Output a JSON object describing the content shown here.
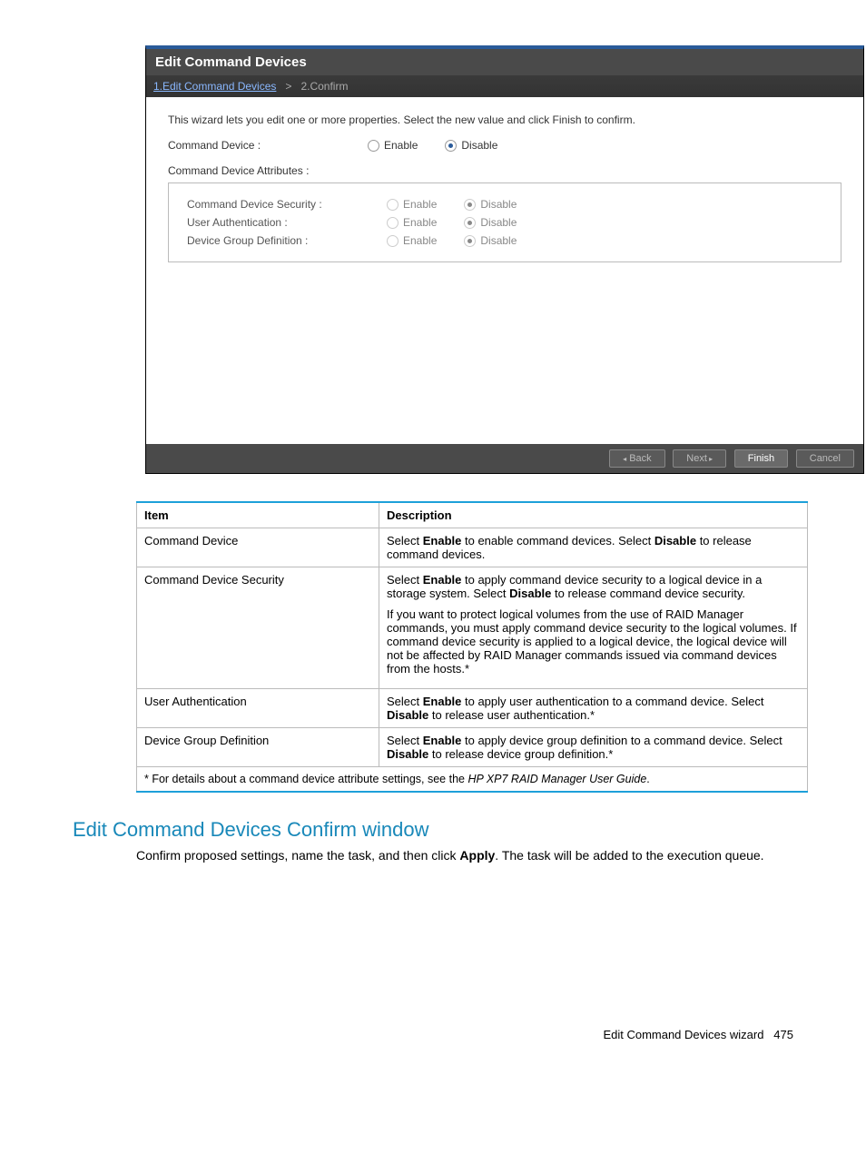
{
  "dialog": {
    "title": "Edit Command Devices",
    "breadcrumb_step1": "1.Edit Command Devices",
    "breadcrumb_sep": ">",
    "breadcrumb_step2": "2.Confirm",
    "intro": "This wizard lets you edit one or more properties. Select the new value and click Finish to confirm.",
    "command_device_label": "Command Device :",
    "enable": "Enable",
    "disable": "Disable",
    "attributes_label": "Command Device Attributes :",
    "attr_security_label": "Command Device Security :",
    "attr_userauth_label": "User Authentication :",
    "attr_groupdef_label": "Device Group Definition :",
    "btn_back": "Back",
    "btn_next": "Next",
    "btn_finish": "Finish",
    "btn_cancel": "Cancel"
  },
  "table": {
    "header_item": "Item",
    "header_desc": "Description",
    "rows": [
      {
        "item": "Command Device",
        "desc_before": "Select ",
        "desc_b1": "Enable",
        "desc_mid1": " to enable command devices. Select ",
        "desc_b2": "Disable",
        "desc_after": " to release command devices."
      },
      {
        "item": "Command Device Security",
        "p1_before": "Select ",
        "p1_b1": "Enable",
        "p1_mid": " to apply command device security to a logical device in a storage system. Select ",
        "p1_b2": "Disable",
        "p1_after": " to release command device security.",
        "p2": "If you want to protect logical volumes from the use of RAID Manager commands, you must apply command device security to the logical volumes. If command device security is applied to a logical device, the logical device will not be affected by RAID Manager commands issued via command devices from the hosts.*"
      },
      {
        "item": "User Authentication",
        "desc_before": "Select ",
        "desc_b1": "Enable",
        "desc_mid1": " to apply user authentication to a command device. Select ",
        "desc_b2": "Disable",
        "desc_after": " to release user authentication.*"
      },
      {
        "item": "Device Group Definition",
        "desc_before": "Select ",
        "desc_b1": "Enable",
        "desc_mid1": " to apply device group definition to a command device. Select ",
        "desc_b2": "Disable",
        "desc_after": " to release device group definition.*"
      }
    ],
    "footnote_before": "* For details about a command device attribute settings, see the ",
    "footnote_italic": "HP XP7 RAID Manager User Guide",
    "footnote_after": "."
  },
  "section": {
    "heading": "Edit Command Devices Confirm window",
    "body_before": "Confirm proposed settings, name the task, and then click ",
    "body_bold": "Apply",
    "body_after": ". The task will be added to the execution queue."
  },
  "footer": {
    "text": "Edit Command Devices wizard",
    "page": "475"
  }
}
